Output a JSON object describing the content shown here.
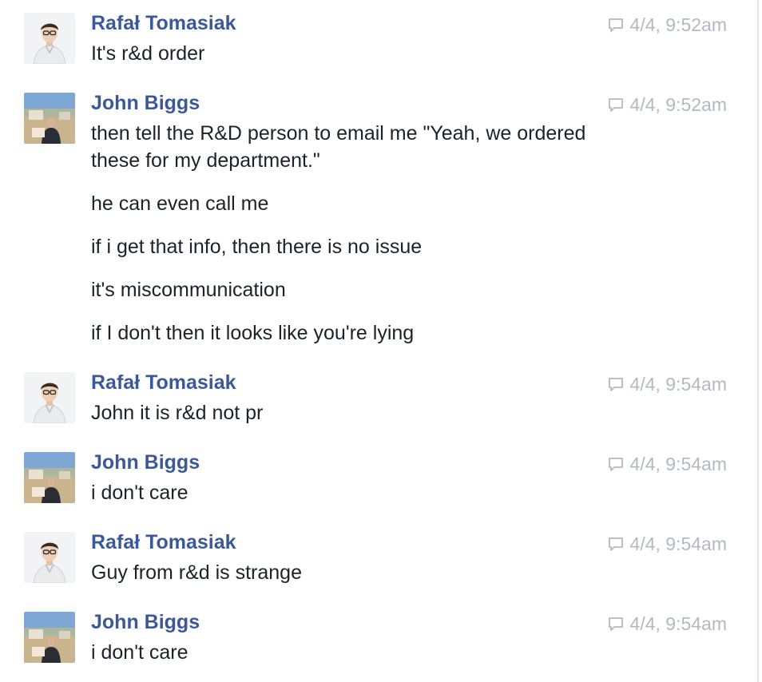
{
  "messages": [
    {
      "author": "Rafał Tomasiak",
      "timestamp": "4/4, 9:52am",
      "avatar": "rafal-avatar",
      "lines": [
        "It's r&d order"
      ]
    },
    {
      "author": "John Biggs",
      "timestamp": "4/4, 9:52am",
      "avatar": "john-avatar",
      "lines": [
        "then tell the R&D person to email me \"Yeah, we ordered",
        "these for my department.\"",
        "he can even call me",
        "if i get that info, then there is no issue",
        "it's miscommunication",
        "if I don't then it looks like you're lying"
      ]
    },
    {
      "author": "Rafał Tomasiak",
      "timestamp": "4/4, 9:54am",
      "avatar": "rafal-avatar",
      "lines": [
        "John it is r&d not pr"
      ]
    },
    {
      "author": "John Biggs",
      "timestamp": "4/4, 9:54am",
      "avatar": "john-avatar",
      "lines": [
        "i don't care"
      ]
    },
    {
      "author": "Rafał Tomasiak",
      "timestamp": "4/4, 9:54am",
      "avatar": "rafal-avatar",
      "lines": [
        "Guy from r&d is strange"
      ]
    },
    {
      "author": "John Biggs",
      "timestamp": "4/4, 9:54am",
      "avatar": "john-avatar",
      "lines": [
        "i don't care"
      ]
    }
  ],
  "colors": {
    "author": "#3b5998",
    "text": "#1d2129",
    "timestamp": "#b4b8c1"
  },
  "icons": {
    "timestamp_icon": "comment-bubble-icon"
  }
}
